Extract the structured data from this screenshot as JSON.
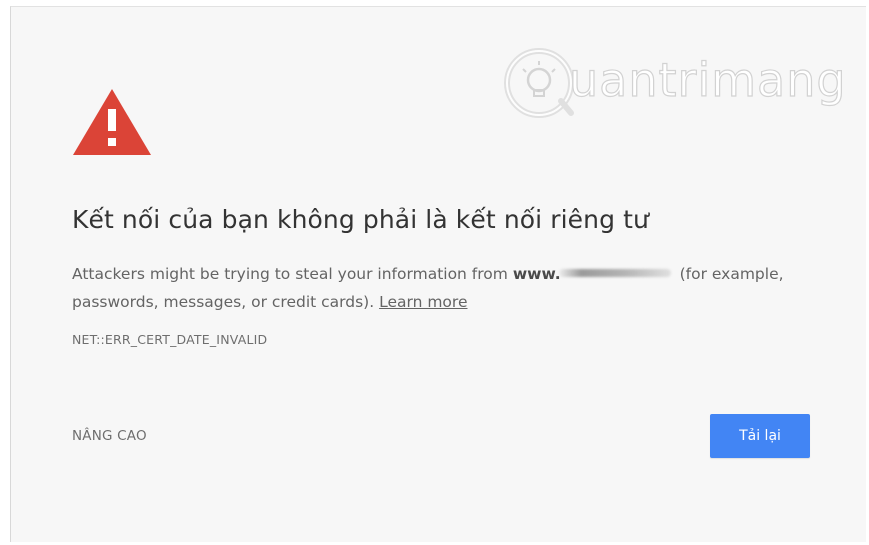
{
  "page": {
    "title": "Kết nối của bạn không phải là kết nối riêng tư",
    "message_prefix": "Attackers might be trying to steal your information from ",
    "domain": "www.",
    "message_suffix": " (for example, passwords, messages, or credit cards). ",
    "learn_more": "Learn more",
    "error_code": "NET::ERR_CERT_DATE_INVALID",
    "advanced_label": "NÂNG CAO",
    "reload_label": "Tải lại"
  },
  "watermark": {
    "text": "uantrimang",
    "icon": "lightbulb-logo-icon"
  },
  "icons": {
    "warning": "warning-triangle-icon"
  },
  "colors": {
    "background": "#f7f7f7",
    "warning_red": "#db4437",
    "button_blue": "#4285f4",
    "title_text": "#333333",
    "body_text": "#646464"
  }
}
